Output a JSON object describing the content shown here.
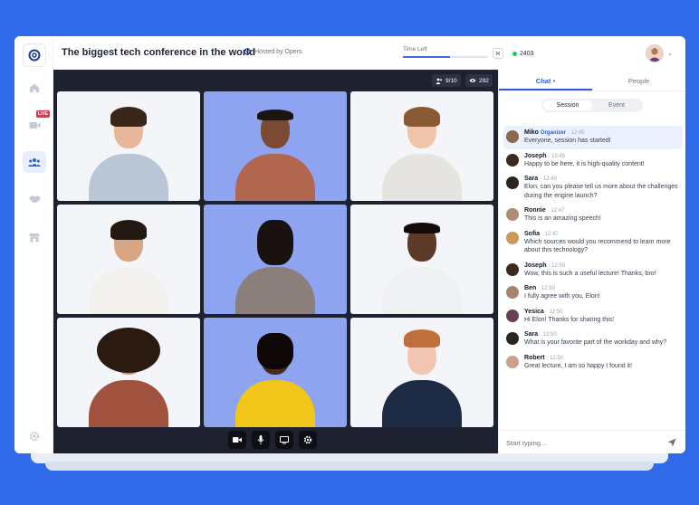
{
  "header": {
    "title": "The biggest tech conference in the world",
    "hosted_by": "Hosted by Opers",
    "time_left_label": "Time Left",
    "time_left_progress": 0.55,
    "online_count": "2403"
  },
  "rail": {
    "live_badge": "LIVE"
  },
  "stage": {
    "speakers": "9/10",
    "viewers": "292"
  },
  "chat": {
    "tabs": [
      "Chat",
      "People"
    ],
    "segments": [
      "Session",
      "Event"
    ],
    "messages": [
      {
        "name": "Miko",
        "role": "Organizer",
        "time": "12:45",
        "text": "Everyone, session has started!",
        "color": "#8a6a52"
      },
      {
        "name": "Joseph",
        "role": "",
        "time": "12:45",
        "text": "Happy to be here, it is high-quality content!",
        "color": "#3b2a20"
      },
      {
        "name": "Sara",
        "role": "",
        "time": "12:45",
        "text": "Elon, can you please tell us more about the challenges during the engine launch?",
        "color": "#2b2422"
      },
      {
        "name": "Ronnie",
        "role": "",
        "time": "12:47",
        "text": "This is an amazing speech!",
        "color": "#b08b77"
      },
      {
        "name": "Sofia",
        "role": "",
        "time": "12:47",
        "text": "Which sources would you recommend to learn more about this technology?",
        "color": "#c99a58"
      },
      {
        "name": "Joseph",
        "role": "",
        "time": "12:50",
        "text": "Wow, this is such a useful lecture! Thanks, bro!",
        "color": "#3b2a20"
      },
      {
        "name": "Ben",
        "role": "",
        "time": "12:50",
        "text": "I fully agree with you, Elon!",
        "color": "#a9836d"
      },
      {
        "name": "Yesica",
        "role": "",
        "time": "12:50",
        "text": "Hi Elon! Thanks for sharing this!",
        "color": "#6a3f55"
      },
      {
        "name": "Sara",
        "role": "",
        "time": "12:50",
        "text": "What is your favorite part of the workday and why?",
        "color": "#2b2422"
      },
      {
        "name": "Robert",
        "role": "",
        "time": "12:50",
        "text": "Great lecture, I am so happy I found it!",
        "color": "#caa090"
      }
    ],
    "input_placeholder": "Start typing..."
  },
  "colors": {
    "accent": "#2f5fd6",
    "background": "#2f6be8",
    "stage": "#1e2230",
    "live": "#e5374b",
    "online": "#22c55e"
  }
}
